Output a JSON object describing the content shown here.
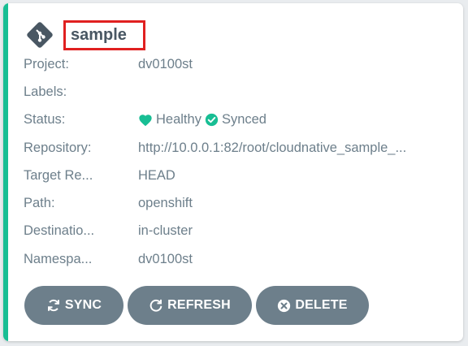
{
  "app": {
    "name": "sample",
    "status_color": "#18be94",
    "icon": "git-icon"
  },
  "fields": [
    {
      "key": "project",
      "label": "Project:",
      "value": "dv0100st"
    },
    {
      "key": "labels",
      "label": "Labels:",
      "value": ""
    },
    {
      "key": "status",
      "label": "Status:",
      "health": "Healthy",
      "sync": "Synced"
    },
    {
      "key": "repository",
      "label": "Repository:",
      "value": "http://10.0.0.1:82/root/cloudnative_sample_..."
    },
    {
      "key": "target_revision",
      "label": "Target Re...",
      "value": "HEAD"
    },
    {
      "key": "path",
      "label": "Path:",
      "value": "openshift"
    },
    {
      "key": "destination",
      "label": "Destinatio...",
      "value": "in-cluster"
    },
    {
      "key": "namespace",
      "label": "Namespa...",
      "value": "dv0100st"
    }
  ],
  "buttons": {
    "sync": "SYNC",
    "refresh": "REFRESH",
    "delete": "DELETE"
  },
  "colors": {
    "healthy": "#18be94",
    "synced": "#18be94",
    "button_bg": "#6d7f8b",
    "highlight_box": "#e02020"
  }
}
